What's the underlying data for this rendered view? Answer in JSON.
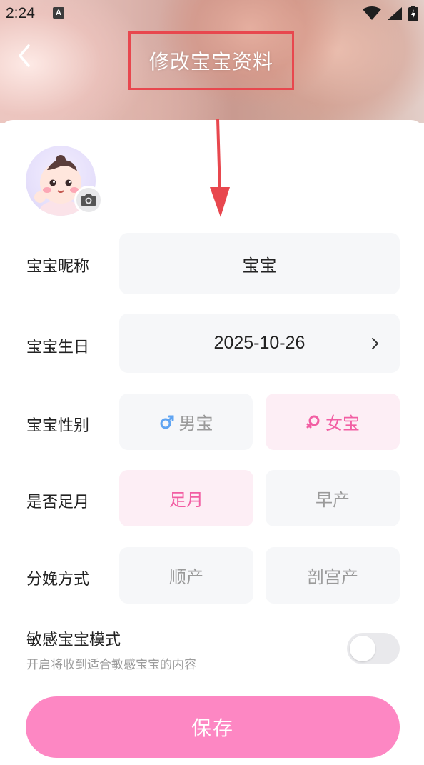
{
  "status_bar": {
    "time": "2:24",
    "notification_icon": "A"
  },
  "header": {
    "title": "修改宝宝资料"
  },
  "form": {
    "nickname": {
      "label": "宝宝昵称",
      "value": "宝宝"
    },
    "birthday": {
      "label": "宝宝生日",
      "value": "2025-10-26"
    },
    "gender": {
      "label": "宝宝性别",
      "options": [
        {
          "label": "男宝",
          "icon": "male-icon",
          "color": "#5fa4f2"
        },
        {
          "label": "女宝",
          "icon": "female-icon",
          "color": "#f25ea3"
        }
      ],
      "selected": "女宝"
    },
    "full_term": {
      "label": "是否足月",
      "options": [
        {
          "label": "足月"
        },
        {
          "label": "早产"
        }
      ],
      "selected": "足月"
    },
    "delivery": {
      "label": "分娩方式",
      "options": [
        {
          "label": "顺产"
        },
        {
          "label": "剖宫产"
        }
      ],
      "selected": ""
    },
    "sensitive_mode": {
      "title": "敏感宝宝模式",
      "subtitle": "开启将收到适合敏感宝宝的内容",
      "enabled": false
    }
  },
  "save_label": "保存",
  "colors": {
    "accent_pink": "#f25ea3",
    "save_button": "#fd87c3",
    "selected_bg": "#fdeef5",
    "field_bg": "#f6f7f9",
    "annotation_red": "#e8474e"
  }
}
